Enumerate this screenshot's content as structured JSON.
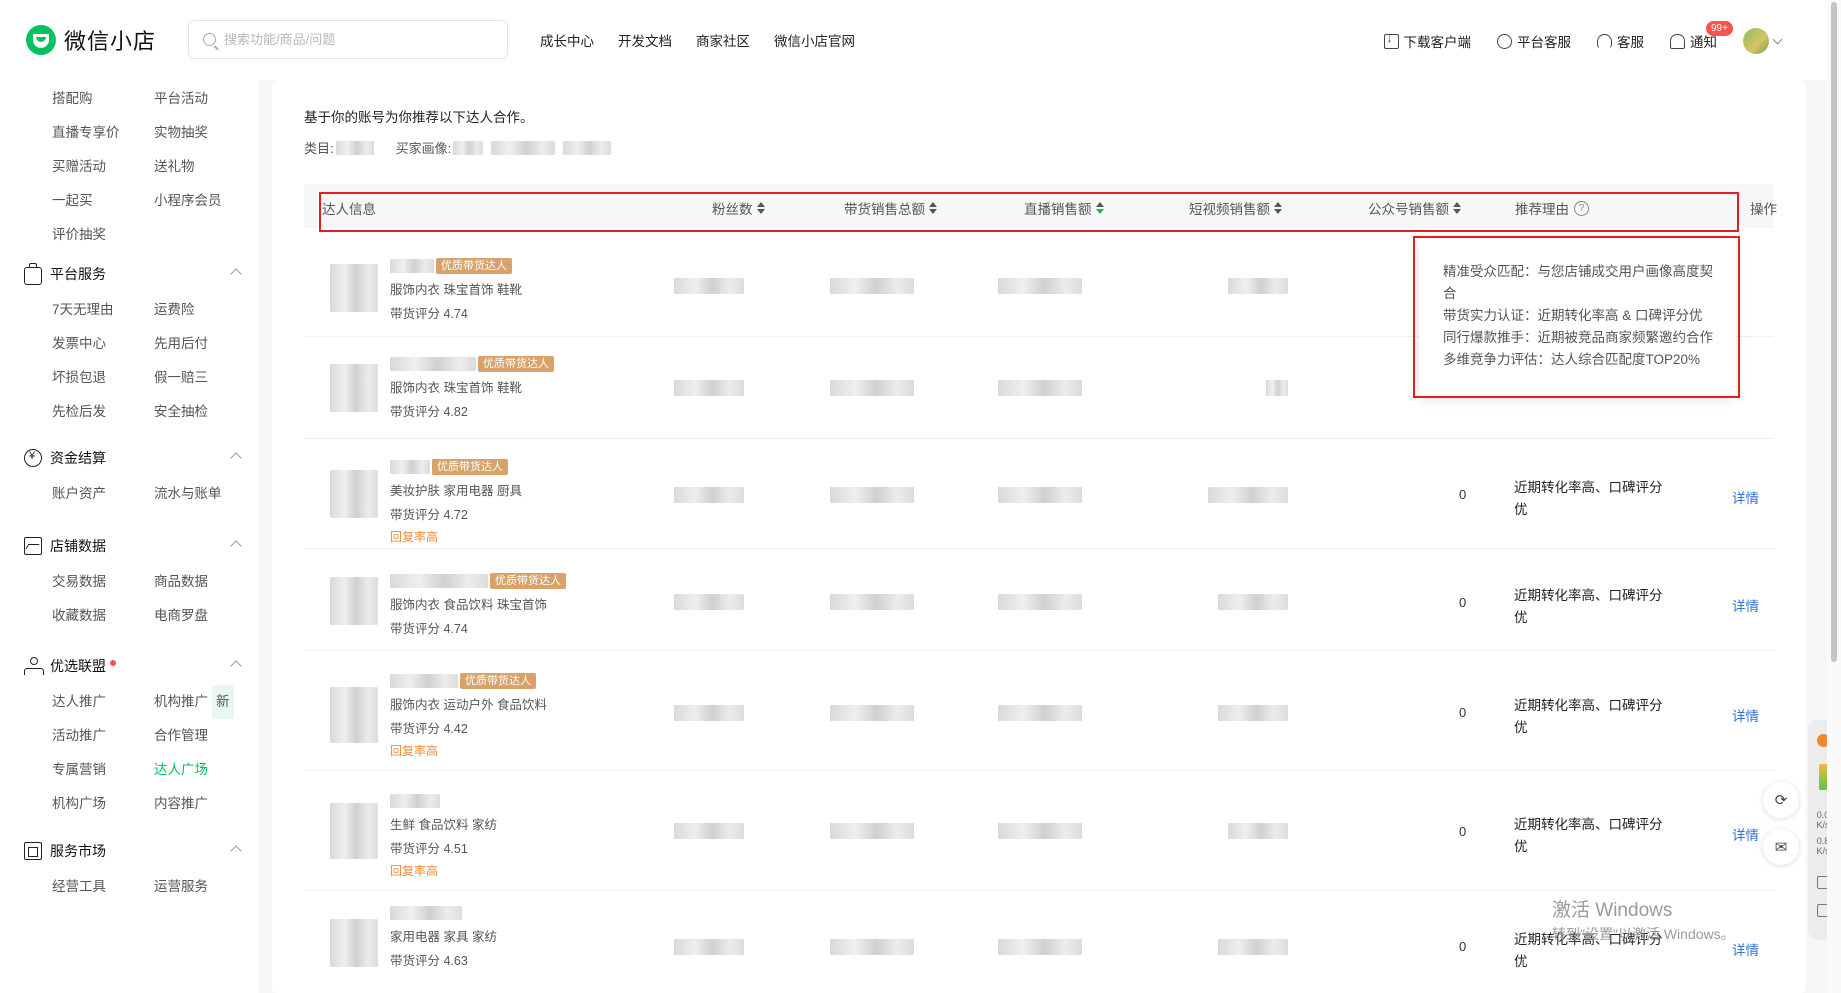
{
  "header": {
    "logo_text": "微信小店",
    "search_placeholder": "搜索功能/商品/问题",
    "nav": [
      "成长中心",
      "开发文档",
      "商家社区",
      "微信小店官网"
    ],
    "tools": {
      "download": "下载客户端",
      "platform_service": "平台客服",
      "service": "客服",
      "notify": "通知",
      "notify_badge": "99+"
    }
  },
  "sidebar": {
    "top_items": [
      "搭配购",
      "平台活动",
      "直播专享价",
      "实物抽奖",
      "买赠活动",
      "送礼物",
      "一起买",
      "小程序会员",
      "评价抽奖"
    ],
    "sections": [
      {
        "title": "平台服务",
        "icon": "bag-icon",
        "items": [
          "7天无理由",
          "运费险",
          "发票中心",
          "先用后付",
          "坏损包退",
          "假一赔三",
          "先检后发",
          "安全抽检"
        ]
      },
      {
        "title": "资金结算",
        "icon": "yen-icon",
        "items": [
          "账户资产",
          "流水与账单"
        ]
      },
      {
        "title": "店铺数据",
        "icon": "chart-icon",
        "items": [
          "交易数据",
          "商品数据",
          "收藏数据",
          "电商罗盘"
        ]
      },
      {
        "title": "优选联盟",
        "icon": "network-icon",
        "items": [
          "达人推广",
          "机构推广",
          "活动推广",
          "合作管理",
          "专属营销",
          "达人广场",
          "机构广场",
          "内容推广"
        ]
      },
      {
        "title": "服务市场",
        "icon": "store-icon",
        "items": [
          "经营工具",
          "运营服务"
        ]
      }
    ],
    "new_tag": "新",
    "active_item": "达人广场"
  },
  "main": {
    "intro": "基于你的账号为你推荐以下达人合作。",
    "category_label": "类目:",
    "persona_label": "买家画像:",
    "table": {
      "headers": {
        "info": "达人信息",
        "fans": "粉丝数",
        "total_sales": "带货销售总额",
        "live_sales": "直播销售额",
        "video_sales": "短视频销售额",
        "oa_sales": "公众号销售额",
        "reason": "推荐理由",
        "action": "操作"
      },
      "tag_label": "优质带货达人",
      "rows": [
        {
          "categories": "服饰内衣 珠宝首饰 鞋靴",
          "score": "带货评分 4.74",
          "extra": "",
          "oa_value": "",
          "reason": "",
          "action": ""
        },
        {
          "categories": "服饰内衣 珠宝首饰 鞋靴",
          "score": "带货评分 4.82",
          "extra": "",
          "oa_value": "",
          "reason": "",
          "action": ""
        },
        {
          "categories": "美妆护肤 家用电器 厨具",
          "score": "带货评分 4.72",
          "extra": "回复率高",
          "oa_value": "0",
          "reason": "近期转化率高、口碑评分优",
          "action": "详情"
        },
        {
          "categories": "服饰内衣 食品饮料 珠宝首饰",
          "score": "带货评分 4.74",
          "extra": "",
          "oa_value": "0",
          "reason": "近期转化率高、口碑评分优",
          "action": "详情"
        },
        {
          "categories": "服饰内衣 运动户外 食品饮料",
          "score": "带货评分 4.42",
          "extra": "回复率高",
          "oa_value": "0",
          "reason": "近期转化率高、口碑评分优",
          "action": "详情"
        },
        {
          "categories": "生鲜 食品饮料 家纺",
          "score": "带货评分 4.51",
          "extra": "回复率高",
          "oa_value": "0",
          "reason": "近期转化率高、口碑评分优",
          "action": "详情"
        },
        {
          "categories": "家用电器 家具 家纺",
          "score": "带货评分 4.63",
          "extra": "",
          "oa_value": "0",
          "reason": "近期转化率高、口碑评分优",
          "action": "详情"
        }
      ]
    },
    "popover": [
      "精准受众匹配：与您店铺成交用户画像高度契合",
      "带货实力认证：近期转化率高 & 口碑评分优",
      "同行爆款推手：近期被竞品商家频繁邀约合作",
      "多维竞争力评估：达人综合匹配度TOP20%"
    ]
  },
  "system": {
    "net_up": "0.0 K/s",
    "net_down": "0.8 K/s",
    "watermark_title": "激活 Windows",
    "watermark_sub": "转到\"设置\"以激活 Windows。"
  }
}
